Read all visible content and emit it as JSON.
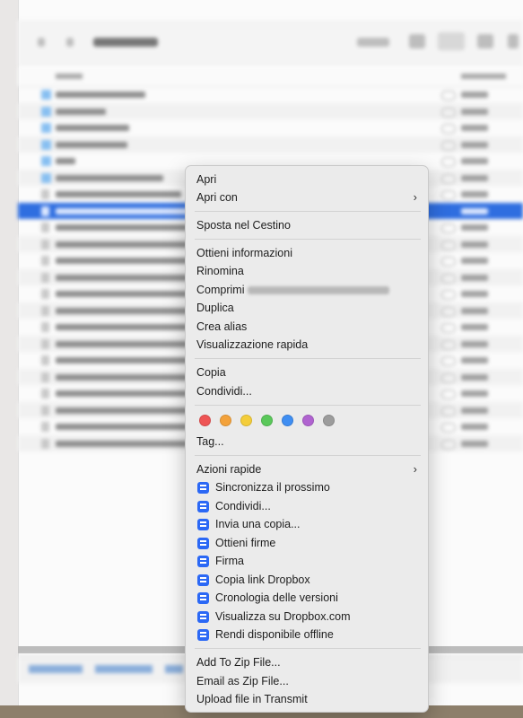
{
  "menu": {
    "open": "Apri",
    "open_with": "Apri con",
    "move_to_trash": "Sposta nel Cestino",
    "get_info": "Ottieni informazioni",
    "rename": "Rinomina",
    "compress": "Comprimi",
    "duplicate": "Duplica",
    "make_alias": "Crea alias",
    "quick_look": "Visualizzazione rapida",
    "copy": "Copia",
    "share": "Condividi...",
    "tags_label": "Tag...",
    "quick_actions": "Azioni rapide",
    "dropbox_items": [
      "Sincronizza il prossimo",
      "Condividi...",
      "Invia una copia...",
      "Ottieni firme",
      "Firma",
      "Copia link Dropbox",
      "Cronologia delle versioni",
      "Visualizza su Dropbox.com",
      "Rendi disponibile offline"
    ],
    "add_to_zip": "Add To Zip File...",
    "email_as_zip": "Email as Zip File...",
    "upload_transmit": "Upload file in Transmit",
    "tag_colors": [
      "#ee5454",
      "#f3a23b",
      "#f4cd3a",
      "#5ac85a",
      "#3f8ef2",
      "#b063d0",
      "#9c9c9c"
    ]
  }
}
